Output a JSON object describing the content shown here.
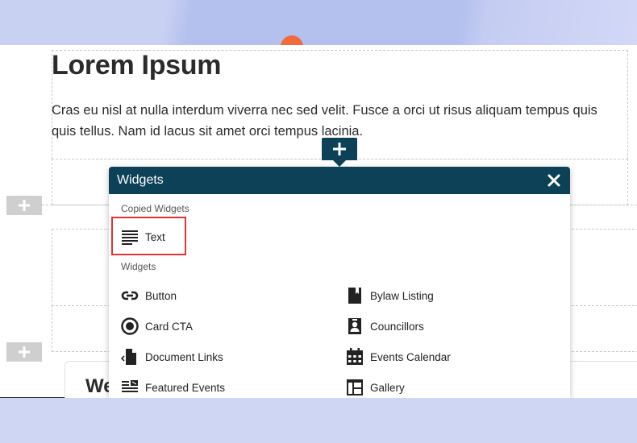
{
  "page": {
    "heading": "Lorem Ipsum",
    "paragraph": "Cras eu nisl at nulla interdum viverra nec sed velit. Fusce a orci ut risus aliquam tempus quis quis tellus. Nam id lacus sit amet orci tempus lacinia.",
    "card_title_partial": "We"
  },
  "modal": {
    "title": "Widgets",
    "copied_label": "Copied Widgets",
    "copied_items": [
      {
        "label": "Text",
        "icon": "text-lines-icon"
      }
    ],
    "widgets_label": "Widgets",
    "widgets": [
      {
        "label": "Button",
        "icon": "link-icon"
      },
      {
        "label": "Bylaw Listing",
        "icon": "book-icon"
      },
      {
        "label": "Card CTA",
        "icon": "target-icon"
      },
      {
        "label": "Councillors",
        "icon": "person-badge-icon"
      },
      {
        "label": "Document Links",
        "icon": "document-code-icon"
      },
      {
        "label": "Events Calendar",
        "icon": "calendar-icon"
      },
      {
        "label": "Featured Events",
        "icon": "featured-list-icon"
      },
      {
        "label": "Gallery",
        "icon": "gallery-icon"
      }
    ]
  },
  "colors": {
    "accent": "#0c4157",
    "highlight": "#e23434",
    "add_button": "#cfcfcf"
  }
}
